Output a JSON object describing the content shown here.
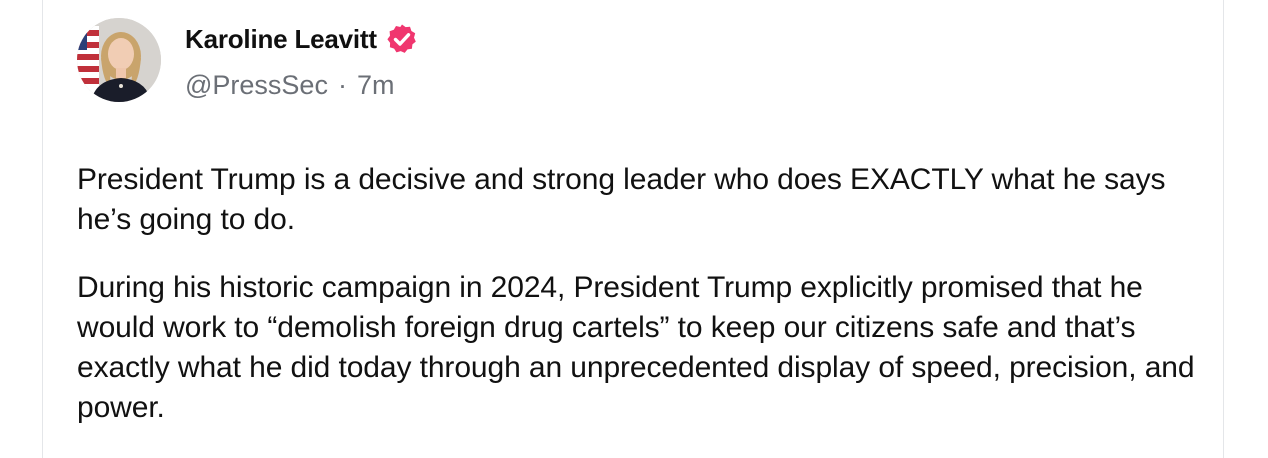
{
  "post": {
    "author": {
      "display_name": "Karoline Leavitt",
      "handle": "@PressSec",
      "verified_icon": "verified-badge-icon",
      "verified_color": "#f0366f"
    },
    "separator": "·",
    "time": "7m",
    "paragraphs": [
      "President Trump is a decisive and strong leader who does EXACTLY what he says he’s going to do.",
      "During his historic campaign in 2024, President Trump explicitly promised that he would work to “demolish foreign drug cartels” to keep our citizens safe and that’s exactly what he did today through an unprecedented display of speed, precision, and power."
    ]
  }
}
